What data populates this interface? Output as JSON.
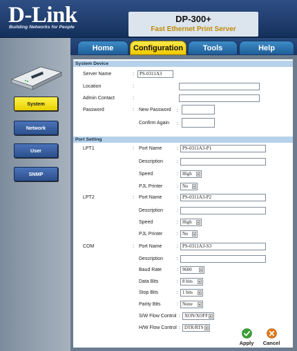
{
  "brand": {
    "name": "D-Link",
    "tagline": "Building Networks for People",
    "model": "DP-300+",
    "product": "Fast Ethernet Print Server"
  },
  "tabs": [
    {
      "label": "Home",
      "active": false
    },
    {
      "label": "Configuration",
      "active": true
    },
    {
      "label": "Tools",
      "active": false
    },
    {
      "label": "Help",
      "active": false
    }
  ],
  "nav": [
    {
      "label": "System",
      "active": true
    },
    {
      "label": "Network",
      "active": false
    },
    {
      "label": "User",
      "active": false
    },
    {
      "label": "SNMP",
      "active": false
    }
  ],
  "system_device": {
    "title": "System Device",
    "server_name": {
      "label": "Server Name",
      "value": "PS-0311A3"
    },
    "location": {
      "label": "Location",
      "value": ""
    },
    "admin_contact": {
      "label": "Admin Contact",
      "value": ""
    },
    "password": {
      "label": "Password",
      "new_label": "New Password",
      "confirm_label": "Confirm Again"
    }
  },
  "port_setting": {
    "title": "Port Setting",
    "lpt1": {
      "label": "LPT1",
      "port_name_label": "Port Name",
      "port_name": "PS-0311A3-P1",
      "description_label": "Description",
      "description": "",
      "speed_label": "Speed",
      "speed": "High",
      "pjl_label": "PJL Printer",
      "pjl": "No"
    },
    "lpt2": {
      "label": "LPT2",
      "port_name_label": "Port Name",
      "port_name": "PS-0311A3-P2",
      "description_label": "Description",
      "description": "",
      "speed_label": "Speed",
      "speed": "High",
      "pjl_label": "PJL Printer",
      "pjl": "No"
    },
    "com": {
      "label": "COM",
      "port_name_label": "Port Name",
      "port_name": "PS-0311A3-S3",
      "description_label": "Description",
      "description": "",
      "baud_label": "Baud Rate",
      "baud": "9600",
      "data_bits_label": "Data Bits",
      "data_bits": "8 bits",
      "stop_bits_label": "Stop Bits",
      "stop_bits": "1 bits",
      "parity_label": "Parity Bits",
      "parity": "None",
      "sw_flow_label": "S/W Flow Control",
      "sw_flow": "XON/XOFF",
      "hw_flow_label": "H/W Flow Control",
      "hw_flow": "DTR/RTS"
    }
  },
  "actions": {
    "apply": "Apply",
    "cancel": "Cancel"
  },
  "colors": {
    "accent_yellow": "#f0c800",
    "nav_blue": "#2c4f8c",
    "section_blue": "#b6d2ea",
    "apply_green": "#3aa034",
    "cancel_orange": "#e07a1a"
  }
}
